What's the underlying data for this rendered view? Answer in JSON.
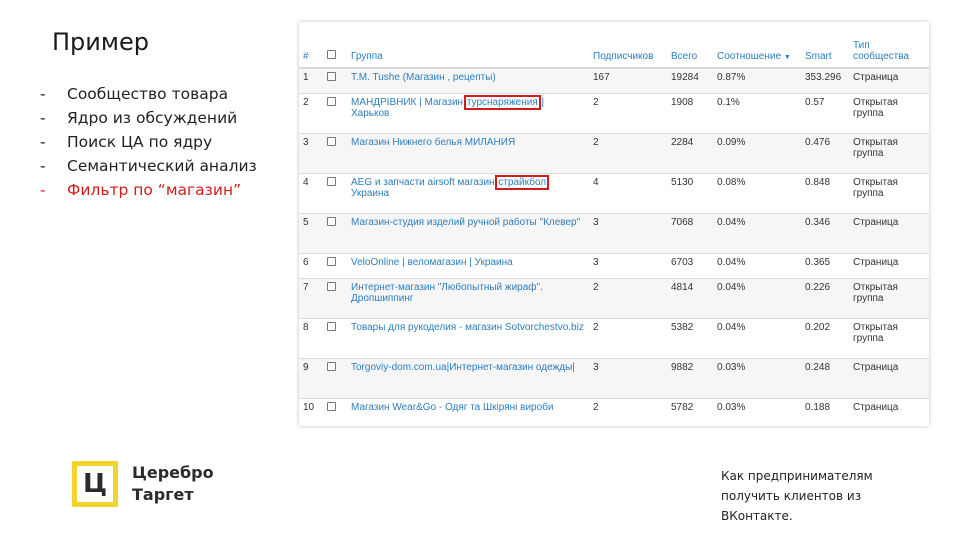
{
  "slide": {
    "title": "Пример",
    "bullets": [
      {
        "dash": "-",
        "text": "Сообщество товара"
      },
      {
        "dash": "-",
        "text": "Ядро из обсуждений"
      },
      {
        "dash": "-",
        "text": "Поиск ЦА по ядру"
      },
      {
        "dash": "-",
        "text": "Семантический анализ"
      },
      {
        "dash": "-",
        "text": "Фильтр по “магазин”"
      }
    ],
    "highlight_color": "#d11c1c"
  },
  "table": {
    "headers": {
      "num": "#",
      "group": "Группа",
      "subscribers": "Подписчиков",
      "total": "Всего",
      "ratio": "Соотношение",
      "ratio_sort_icon": "caret-down-icon",
      "smart": "Smart",
      "type_line1": "Тип",
      "type_line2": "сообщества"
    },
    "rows": [
      {
        "num": "1",
        "group_pre": "T.M. Tushe (Магазин , рецепты)",
        "group_box": "",
        "group_post": "",
        "subscribers": "167",
        "total": "19284",
        "ratio": "0.87%",
        "smart": "353.296",
        "type": "Страница"
      },
      {
        "num": "2",
        "group_pre": "МАНДРІВНИК | Магазин ",
        "group_box": "турснаряжения",
        "group_post": " | Харьков",
        "subscribers": "2",
        "total": "1908",
        "ratio": "0.1%",
        "smart": "0.57",
        "type": "Открытая группа"
      },
      {
        "num": "3",
        "group_pre": "Магазин Нижнего белья МИЛАНИЯ",
        "group_box": "",
        "group_post": "",
        "subscribers": "2",
        "total": "2284",
        "ratio": "0.09%",
        "smart": "0.476",
        "type": "Открытая группа"
      },
      {
        "num": "4",
        "group_pre": "AEG и запчасти airsoft магазин ",
        "group_box": "страйкбол",
        "group_post": " Украина",
        "subscribers": "4",
        "total": "5130",
        "ratio": "0.08%",
        "smart": "0.848",
        "type": "Открытая группа"
      },
      {
        "num": "5",
        "group_pre": "Магазин-студия изделий ручной работы \"Клевер\"",
        "group_box": "",
        "group_post": "",
        "subscribers": "3",
        "total": "7068",
        "ratio": "0.04%",
        "smart": "0.346",
        "type": "Страница"
      },
      {
        "num": "6",
        "group_pre": "VeloOnline | веломагазин | Украина",
        "group_box": "",
        "group_post": "",
        "subscribers": "3",
        "total": "6703",
        "ratio": "0.04%",
        "smart": "0.365",
        "type": "Страница"
      },
      {
        "num": "7",
        "group_pre": "Интернет-магазин \"Любопытный жираф\". Дропшиппинг",
        "group_box": "",
        "group_post": "",
        "subscribers": "2",
        "total": "4814",
        "ratio": "0.04%",
        "smart": "0.226",
        "type": "Открытая группа"
      },
      {
        "num": "8",
        "group_pre": "Товары для рукоделия - магазин Sotvorchestvo.biz",
        "group_box": "",
        "group_post": "",
        "subscribers": "2",
        "total": "5382",
        "ratio": "0.04%",
        "smart": "0.202",
        "type": "Открытая группа"
      },
      {
        "num": "9",
        "group_pre": "Torgoviy-dom.com.ua|Интернет-магазин одежды|",
        "group_box": "",
        "group_post": "",
        "subscribers": "3",
        "total": "9882",
        "ratio": "0.03%",
        "smart": "0.248",
        "type": "Страница"
      },
      {
        "num": "10",
        "group_pre": "Магазин Wear&Go - Одяг та Шкіряні вироби",
        "group_box": "",
        "group_post": "",
        "subscribers": "2",
        "total": "5782",
        "ratio": "0.03%",
        "smart": "0.188",
        "type": "Страница"
      }
    ]
  },
  "footer": {
    "logo_letter": "Ц",
    "logo_line1": "Церебро",
    "logo_line2": "Таргет",
    "logo_color": "#f5d22c",
    "caption": "Как предпринимателям получить клиентов из ВКонтакте."
  }
}
